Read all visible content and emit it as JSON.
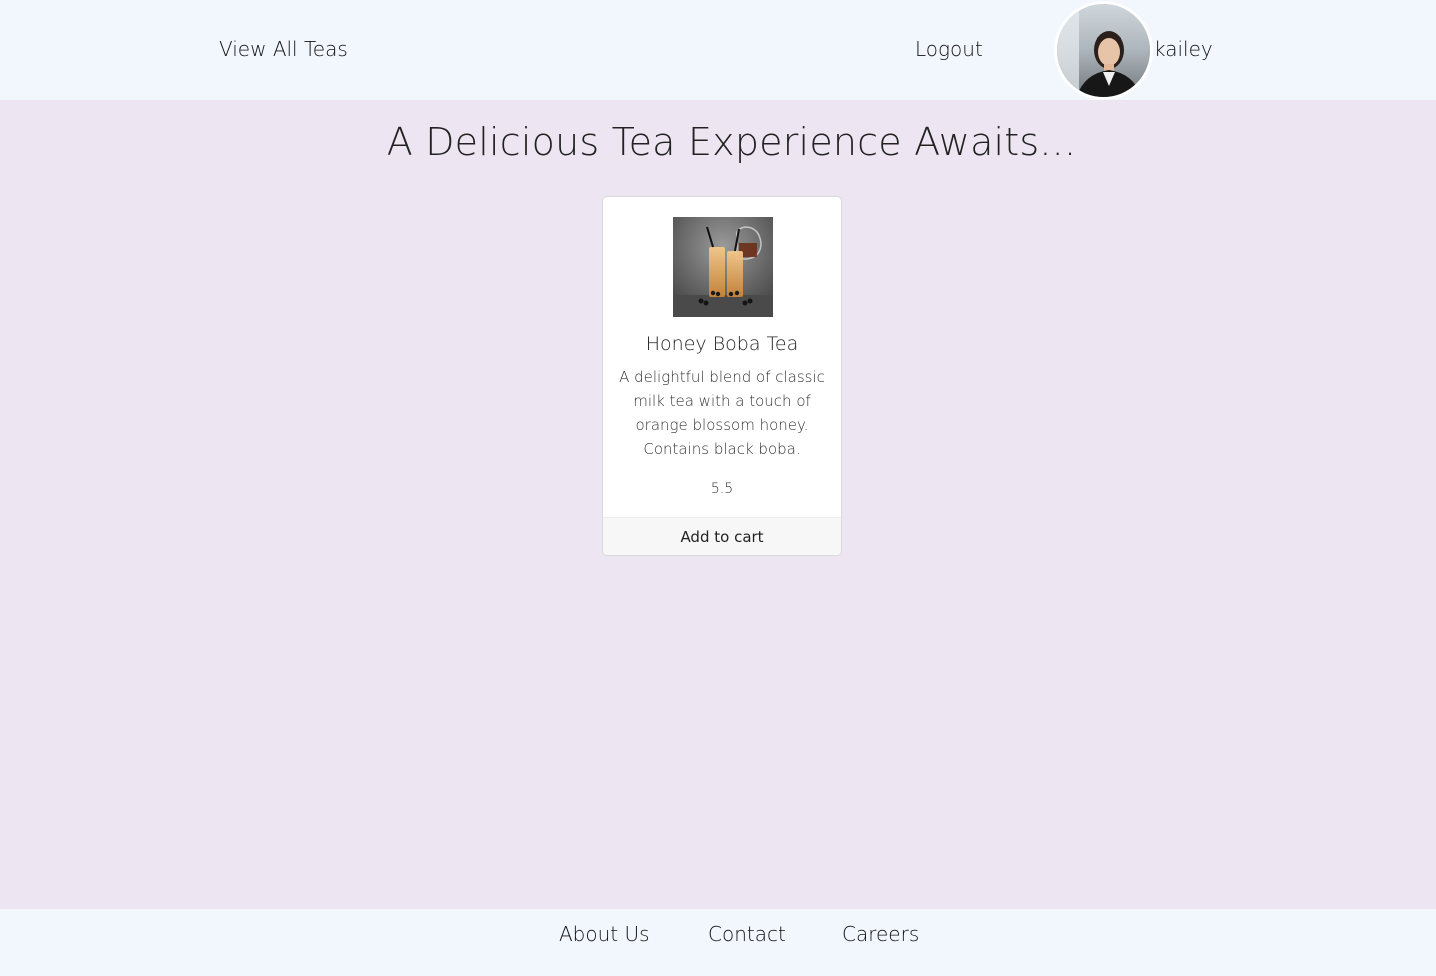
{
  "header": {
    "view_all_label": "View All Teas",
    "logout_label": "Logout",
    "username": "kailey"
  },
  "hero": {
    "title": "A Delicious Tea Experience Awaits..."
  },
  "products": [
    {
      "name": "Honey Boba Tea",
      "description": "A delightful blend of classic milk tea with a touch of orange blossom honey. Contains black boba.",
      "price": "5.5",
      "add_to_cart_label": "Add to cart"
    }
  ],
  "footer": {
    "about_label": "About Us",
    "contact_label": "Contact",
    "careers_label": "Careers"
  }
}
